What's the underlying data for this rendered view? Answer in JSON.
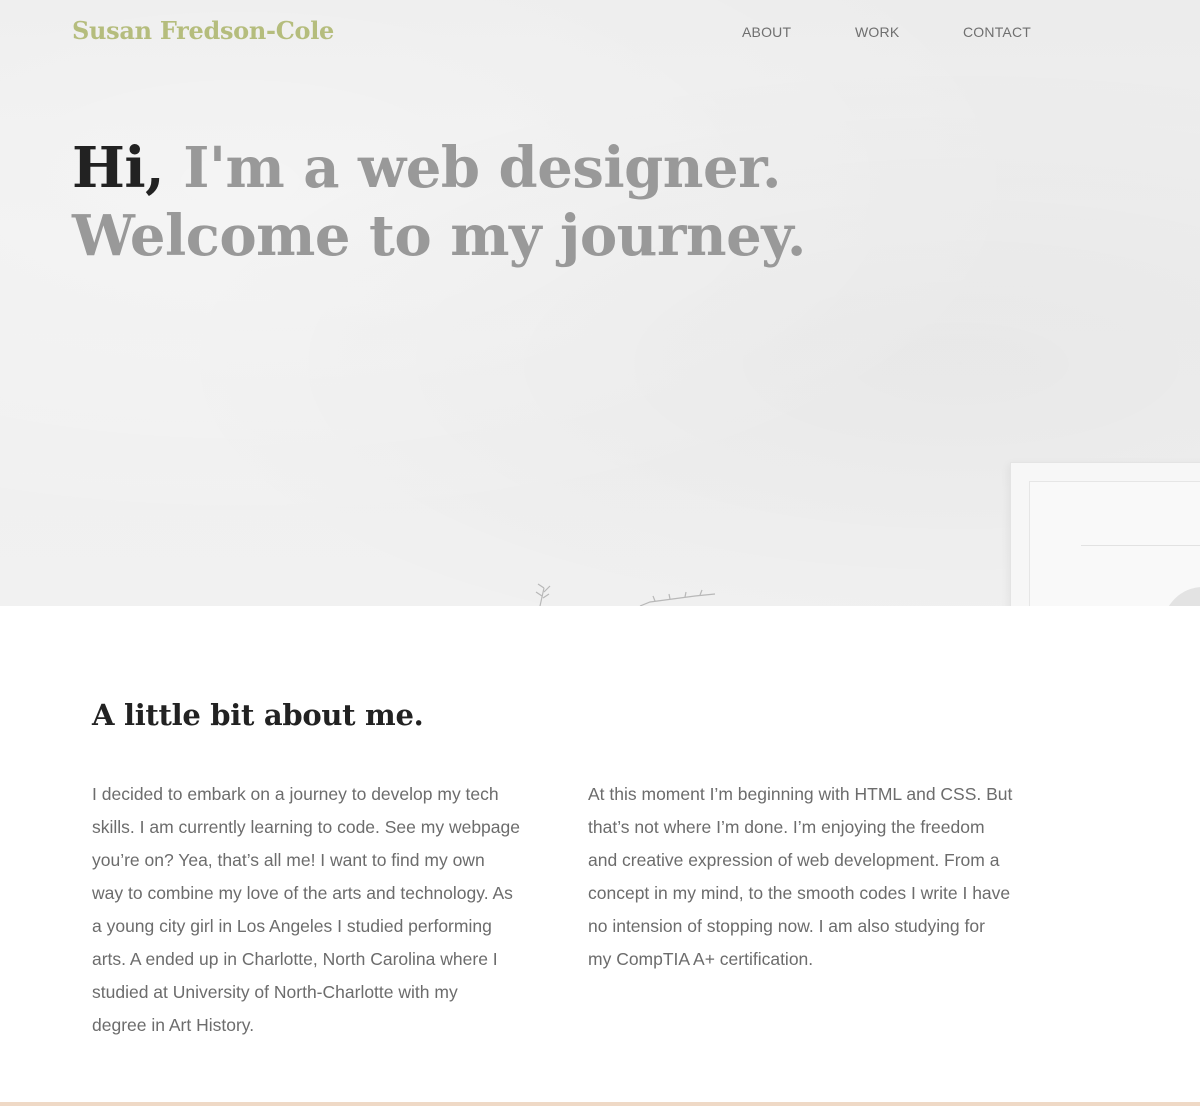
{
  "brand": {
    "name": "Susan Fredson-Cole",
    "color": "#b5bd7d"
  },
  "nav": {
    "items": [
      {
        "label": "ABOUT"
      },
      {
        "label": "WORK"
      },
      {
        "label": "CONTACT"
      }
    ]
  },
  "hero": {
    "greeting": "Hi,",
    "line1_rest": "I'm a web designer.",
    "line2": "Welcome to my journey."
  },
  "about": {
    "title": "A little bit about me.",
    "left_lines": [
      "I decided to embark on a journey to develop my tech",
      "skills. I am currently learning to code. See my webpage",
      "you’re on? Yea, that’s all me! I want to find my own",
      "way to combine my love of the arts and technology. As",
      "a young city girl in Los Angeles I studied performing",
      "arts. A ended up in Charlotte, North Carolina where I",
      "studied at University of North-Charlotte with my",
      "degree in Art History."
    ],
    "right_lines": [
      "At this moment I’m beginning with HTML and CSS. But",
      "that’s not where I’m done. I’m enjoying the freedom",
      "and creative expression of web development. From a",
      "concept in my mind, to the smooth codes I write I have",
      "no intension of stopping now. I am also studying for",
      "my CompTIA A+ certification."
    ]
  },
  "colors": {
    "accent": "#b5bd7d",
    "heading_dark": "#222222",
    "heading_muted": "#999999",
    "body_text": "#6c6c6c",
    "footer_bar": "#efd9c6"
  }
}
